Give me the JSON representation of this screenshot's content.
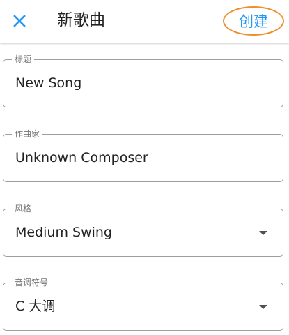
{
  "app_bar": {
    "title": "新歌曲",
    "create_label": "创建",
    "close_icon": "close-icon",
    "accent_color": "#2196f3",
    "highlight_color": "#ee8f2d"
  },
  "form": {
    "title": {
      "label": "标题",
      "value": "New Song"
    },
    "composer": {
      "label": "作曲家",
      "value": "Unknown Composer"
    },
    "style": {
      "label": "风格",
      "value": "Medium Swing",
      "icon": "dropdown-arrow-icon"
    },
    "key": {
      "label": "音调符号",
      "value": "C 大调",
      "icon": "dropdown-arrow-icon"
    }
  }
}
